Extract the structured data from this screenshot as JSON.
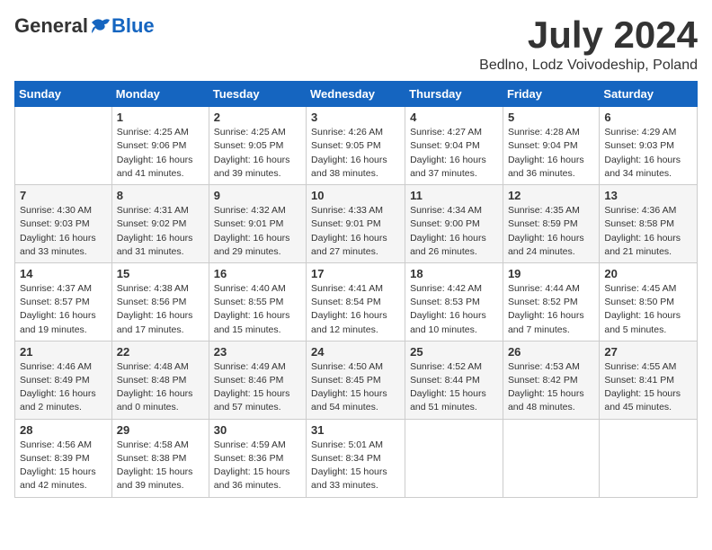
{
  "logo": {
    "general": "General",
    "blue": "Blue"
  },
  "header": {
    "month": "July 2024",
    "location": "Bedlno, Lodz Voivodeship, Poland"
  },
  "weekdays": [
    "Sunday",
    "Monday",
    "Tuesday",
    "Wednesday",
    "Thursday",
    "Friday",
    "Saturday"
  ],
  "weeks": [
    [
      {
        "day": "",
        "info": ""
      },
      {
        "day": "1",
        "info": "Sunrise: 4:25 AM\nSunset: 9:06 PM\nDaylight: 16 hours\nand 41 minutes."
      },
      {
        "day": "2",
        "info": "Sunrise: 4:25 AM\nSunset: 9:05 PM\nDaylight: 16 hours\nand 39 minutes."
      },
      {
        "day": "3",
        "info": "Sunrise: 4:26 AM\nSunset: 9:05 PM\nDaylight: 16 hours\nand 38 minutes."
      },
      {
        "day": "4",
        "info": "Sunrise: 4:27 AM\nSunset: 9:04 PM\nDaylight: 16 hours\nand 37 minutes."
      },
      {
        "day": "5",
        "info": "Sunrise: 4:28 AM\nSunset: 9:04 PM\nDaylight: 16 hours\nand 36 minutes."
      },
      {
        "day": "6",
        "info": "Sunrise: 4:29 AM\nSunset: 9:03 PM\nDaylight: 16 hours\nand 34 minutes."
      }
    ],
    [
      {
        "day": "7",
        "info": "Sunrise: 4:30 AM\nSunset: 9:03 PM\nDaylight: 16 hours\nand 33 minutes."
      },
      {
        "day": "8",
        "info": "Sunrise: 4:31 AM\nSunset: 9:02 PM\nDaylight: 16 hours\nand 31 minutes."
      },
      {
        "day": "9",
        "info": "Sunrise: 4:32 AM\nSunset: 9:01 PM\nDaylight: 16 hours\nand 29 minutes."
      },
      {
        "day": "10",
        "info": "Sunrise: 4:33 AM\nSunset: 9:01 PM\nDaylight: 16 hours\nand 27 minutes."
      },
      {
        "day": "11",
        "info": "Sunrise: 4:34 AM\nSunset: 9:00 PM\nDaylight: 16 hours\nand 26 minutes."
      },
      {
        "day": "12",
        "info": "Sunrise: 4:35 AM\nSunset: 8:59 PM\nDaylight: 16 hours\nand 24 minutes."
      },
      {
        "day": "13",
        "info": "Sunrise: 4:36 AM\nSunset: 8:58 PM\nDaylight: 16 hours\nand 21 minutes."
      }
    ],
    [
      {
        "day": "14",
        "info": "Sunrise: 4:37 AM\nSunset: 8:57 PM\nDaylight: 16 hours\nand 19 minutes."
      },
      {
        "day": "15",
        "info": "Sunrise: 4:38 AM\nSunset: 8:56 PM\nDaylight: 16 hours\nand 17 minutes."
      },
      {
        "day": "16",
        "info": "Sunrise: 4:40 AM\nSunset: 8:55 PM\nDaylight: 16 hours\nand 15 minutes."
      },
      {
        "day": "17",
        "info": "Sunrise: 4:41 AM\nSunset: 8:54 PM\nDaylight: 16 hours\nand 12 minutes."
      },
      {
        "day": "18",
        "info": "Sunrise: 4:42 AM\nSunset: 8:53 PM\nDaylight: 16 hours\nand 10 minutes."
      },
      {
        "day": "19",
        "info": "Sunrise: 4:44 AM\nSunset: 8:52 PM\nDaylight: 16 hours\nand 7 minutes."
      },
      {
        "day": "20",
        "info": "Sunrise: 4:45 AM\nSunset: 8:50 PM\nDaylight: 16 hours\nand 5 minutes."
      }
    ],
    [
      {
        "day": "21",
        "info": "Sunrise: 4:46 AM\nSunset: 8:49 PM\nDaylight: 16 hours\nand 2 minutes."
      },
      {
        "day": "22",
        "info": "Sunrise: 4:48 AM\nSunset: 8:48 PM\nDaylight: 16 hours\nand 0 minutes."
      },
      {
        "day": "23",
        "info": "Sunrise: 4:49 AM\nSunset: 8:46 PM\nDaylight: 15 hours\nand 57 minutes."
      },
      {
        "day": "24",
        "info": "Sunrise: 4:50 AM\nSunset: 8:45 PM\nDaylight: 15 hours\nand 54 minutes."
      },
      {
        "day": "25",
        "info": "Sunrise: 4:52 AM\nSunset: 8:44 PM\nDaylight: 15 hours\nand 51 minutes."
      },
      {
        "day": "26",
        "info": "Sunrise: 4:53 AM\nSunset: 8:42 PM\nDaylight: 15 hours\nand 48 minutes."
      },
      {
        "day": "27",
        "info": "Sunrise: 4:55 AM\nSunset: 8:41 PM\nDaylight: 15 hours\nand 45 minutes."
      }
    ],
    [
      {
        "day": "28",
        "info": "Sunrise: 4:56 AM\nSunset: 8:39 PM\nDaylight: 15 hours\nand 42 minutes."
      },
      {
        "day": "29",
        "info": "Sunrise: 4:58 AM\nSunset: 8:38 PM\nDaylight: 15 hours\nand 39 minutes."
      },
      {
        "day": "30",
        "info": "Sunrise: 4:59 AM\nSunset: 8:36 PM\nDaylight: 15 hours\nand 36 minutes."
      },
      {
        "day": "31",
        "info": "Sunrise: 5:01 AM\nSunset: 8:34 PM\nDaylight: 15 hours\nand 33 minutes."
      },
      {
        "day": "",
        "info": ""
      },
      {
        "day": "",
        "info": ""
      },
      {
        "day": "",
        "info": ""
      }
    ]
  ]
}
